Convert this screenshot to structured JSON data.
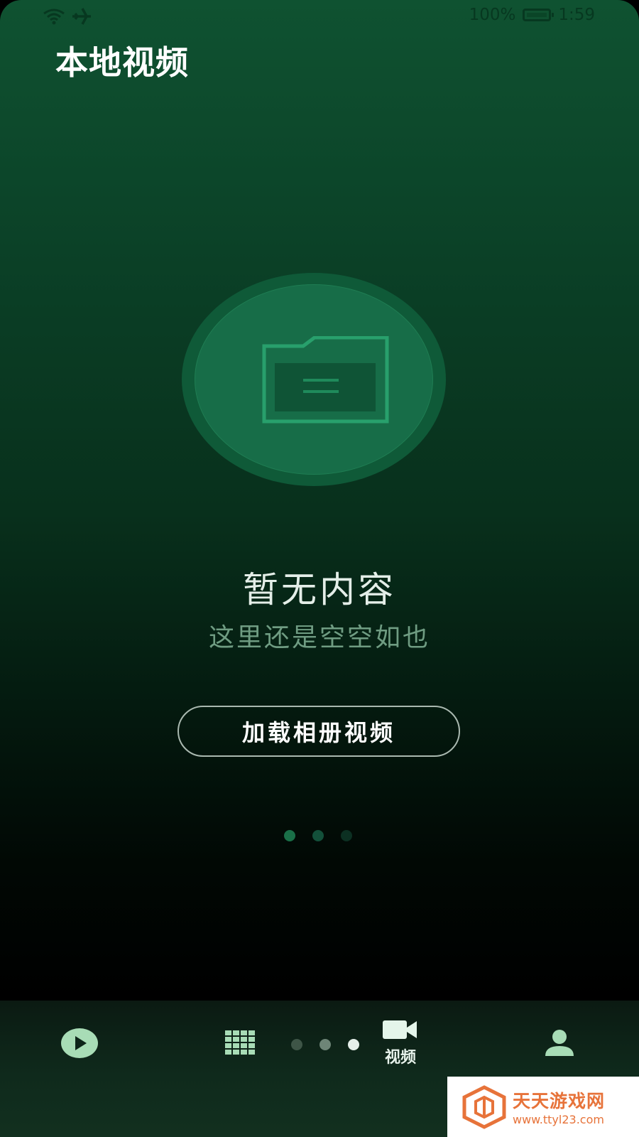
{
  "status_bar": {
    "battery_percent": "100%",
    "time": "1:59",
    "icons": [
      "wifi-icon",
      "airplane-icon",
      "battery-icon"
    ]
  },
  "header": {
    "title": "本地视频"
  },
  "empty_state": {
    "icon": "folder-icon",
    "title": "暂无内容",
    "subtitle": "这里还是空空如也",
    "button_label": "加载相册视频"
  },
  "pager": {
    "total": 3,
    "active_index": 0
  },
  "bottom_nav": {
    "items": [
      {
        "icon": "play-circle-icon",
        "label": ""
      },
      {
        "icon": "grid-icon",
        "label": ""
      },
      {
        "icon": "video-camera-icon",
        "label": "视频",
        "active": true
      },
      {
        "icon": "person-icon",
        "label": ""
      }
    ],
    "dots_total": 3,
    "dots_active_index": 2
  },
  "watermark": {
    "name": "天天游戏网",
    "url": "www.ttyl23.com"
  },
  "colors": {
    "accent": "#1a7048",
    "nav_icon": "#a8dcb6",
    "watermark": "#e7733a"
  }
}
